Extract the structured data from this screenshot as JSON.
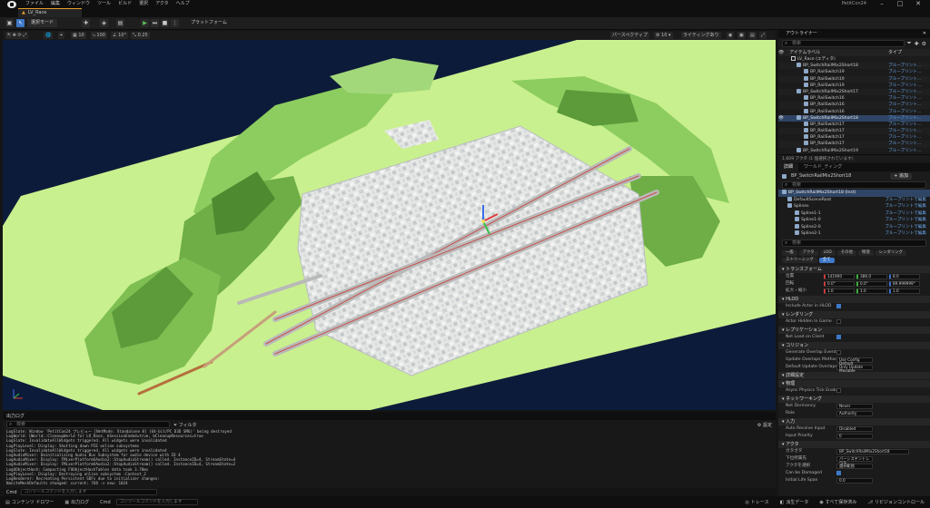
{
  "menu": [
    "ファイル",
    "編集",
    "ウィンドウ",
    "ツール",
    "ビルド",
    "選択",
    "アクタ",
    "ヘルプ"
  ],
  "project_name": "PetitCon24",
  "level_tab": "LV_Race",
  "toolbar": {
    "mode": "選択モード",
    "platform": "プラットフォーム"
  },
  "viewport_toolbar": {
    "grid": "10",
    "rotate": "10°",
    "scale": "0.25",
    "camera_speed": "100",
    "perspective": "パースペクティブ",
    "lit": "ライティングあり"
  },
  "outliner": {
    "title": "アウトライナー",
    "search_placeholder": "検索",
    "col_label": "アイテムラベル",
    "col_type": "タイプ",
    "rows": [
      {
        "name": "LV_Race (エディタ)",
        "type": "",
        "kind": "level",
        "sel": false
      },
      {
        "name": "BP_SwitchRailMix2Short18",
        "type": "ブループリント...",
        "kind": "actor",
        "sel": false
      },
      {
        "name": "BP_RailSwitch19",
        "type": "ブループリント...",
        "kind": "actor",
        "sel": false
      },
      {
        "name": "BP_RailSwitch19",
        "type": "ブループリント...",
        "kind": "actor",
        "sel": false
      },
      {
        "name": "BP_RailSwitch19",
        "type": "ブループリント...",
        "kind": "actor",
        "sel": false
      },
      {
        "name": "BP_SwitchRailMix2Short17",
        "type": "ブループリント...",
        "kind": "actor",
        "sel": false
      },
      {
        "name": "BP_RailSwitch16",
        "type": "ブループリント...",
        "kind": "actor",
        "sel": false
      },
      {
        "name": "BP_RailSwitch16",
        "type": "ブループリント...",
        "kind": "actor",
        "sel": false
      },
      {
        "name": "BP_RailSwitch16",
        "type": "ブループリント...",
        "kind": "actor",
        "sel": false
      },
      {
        "name": "BP_SwitchRailMix2Short18",
        "type": "ブループリント...",
        "kind": "actor",
        "sel": true
      },
      {
        "name": "BP_RailSwitch17",
        "type": "ブループリント...",
        "kind": "actor",
        "sel": false
      },
      {
        "name": "BP_RailSwitch17",
        "type": "ブループリント...",
        "kind": "actor",
        "sel": false
      },
      {
        "name": "BP_RailSwitch17",
        "type": "ブループリント...",
        "kind": "actor",
        "sel": false
      },
      {
        "name": "BP_RailSwitch17",
        "type": "ブループリント...",
        "kind": "actor",
        "sel": false
      },
      {
        "name": "BP_SwitchRailMix2Short19",
        "type": "ブループリント...",
        "kind": "actor",
        "sel": false
      }
    ],
    "footer": "1,609 アクタ (1 個選択されています)"
  },
  "details": {
    "tab_details": "詳細",
    "tab_world": "ワールド_ティング",
    "actor_name": "BP_SwitchRailMix2Short18",
    "add_label": "+ 追加",
    "components": [
      {
        "name": "BP_SwitchRailMix2Short18 (Inst)",
        "link": "",
        "sel": true
      },
      {
        "name": "DefaultSceneRoot",
        "link": "ブループリントで編集",
        "sel": false
      },
      {
        "name": "Splines",
        "link": "ブループリントで編集",
        "sel": false
      },
      {
        "name": "Spline1-1",
        "link": "ブループリントで編集",
        "sel": false
      },
      {
        "name": "Spline1-0",
        "link": "ブループリントで編集",
        "sel": false
      },
      {
        "name": "Spline2-0",
        "link": "ブループリントで編集",
        "sel": false
      },
      {
        "name": "Spline2-1",
        "link": "ブループリントで編集",
        "sel": false
      }
    ],
    "categories": [
      "一般",
      "アクタ",
      "LOD",
      "その他",
      "物理",
      "レンダリング",
      "ストリーミング",
      "全て"
    ],
    "transform_section": "トランスフォーム",
    "transform_rows": [
      {
        "label": "位置",
        "x": "141900",
        "y": "386.0",
        "z": "8.0"
      },
      {
        "label": "回転",
        "x": "0.0°",
        "y": "0.0°",
        "z": "89.999999°"
      },
      {
        "label": "拡大・縮小",
        "x": "1.0",
        "y": "1.0",
        "z": "1.0"
      }
    ],
    "sections": [
      {
        "title": "HLOD",
        "props": [
          {
            "label": "Include Actor in HLOD",
            "kind": "check",
            "value": "on"
          }
        ]
      },
      {
        "title": "レンダリング",
        "props": [
          {
            "label": "Actor Hidden In Game",
            "kind": "check",
            "value": "off"
          }
        ]
      },
      {
        "title": "レプリケーション",
        "props": [
          {
            "label": "Net Load on Client",
            "kind": "check",
            "value": "on"
          }
        ]
      },
      {
        "title": "コリジョン",
        "props": [
          {
            "label": "Generate Overlap Events During...",
            "kind": "check",
            "value": "off"
          },
          {
            "label": "Update Overlaps Method During L...",
            "kind": "select",
            "value": "Use Config Default"
          },
          {
            "label": "Default Update Overlaps Method...",
            "kind": "select",
            "value": "Only Update Movable"
          }
        ]
      },
      {
        "title": "詳細設定",
        "props": []
      },
      {
        "title": "物理",
        "props": [
          {
            "label": "Async Physics Tick Enabled",
            "kind": "check",
            "value": "off"
          }
        ]
      },
      {
        "title": "ネットワーキング",
        "props": [
          {
            "label": "Net Dormancy",
            "kind": "select",
            "value": "Never"
          },
          {
            "label": "Role",
            "kind": "select",
            "value": "Authority"
          }
        ]
      },
      {
        "title": "入力",
        "props": [
          {
            "label": "Auto Receive Input",
            "kind": "select",
            "value": "Disabled"
          },
          {
            "label": "Input Priority",
            "kind": "text",
            "value": "0"
          }
        ]
      },
      {
        "title": "アクタ",
        "props": [
          {
            "label": "ガタガタ",
            "kind": "text",
            "value": "BP_SwitchRailMix2Short18"
          },
          {
            "label": "下位所属先",
            "kind": "text",
            "value": "パーシステントレベル"
          },
          {
            "label": "アクタを選択",
            "kind": "select",
            "value": "選択範囲"
          },
          {
            "label": "Can be Damaged",
            "kind": "check",
            "value": "on"
          },
          {
            "label": "Initial Life Span",
            "kind": "text",
            "value": "0.0"
          }
        ]
      }
    ]
  },
  "output_log": {
    "title": "出力ログ",
    "search_placeholder": "検索",
    "filter_label": "フィルタ",
    "settings_label": "設定",
    "lines": [
      "LogSlate: Window 'PetitCon24 プレビュー [NetMode: Standalone 0] (64-bit/PC D3D SM6)' being destroyed",
      "LogWorld: UWorld::CleanupWorld for LV_Race, bSessionEnded=true, bCleanupResources=true",
      "LogSlate: InvalidateAllWidgets triggered.  All widgets were invalidated",
      "LogPlayLevel: Display: Shutting down PIE online subsystems",
      "LogSlate: InvalidateAllWidgets triggered.  All widgets were invalidated",
      "LogAudioMixer: Deinitializing Audio Bus Subsystem for audio device with ID 4",
      "LogAudioMixer: Display: FMixerPlatformXAudio2::StopAudioStream() called. InstanceID=4, StreamState=4",
      "LogAudioMixer: Display: FMixerPlatformXAudio2::StopAudioStream() called. InstanceID=4, StreamState=2",
      "LogUObjectHash: Compacting FUObjectHashTables data took   3.78ms",
      "LogPlayLevel: Display: Destroying online subsystem :Context_2",
      "LogRenderer: Recreating Persistent SDFs due to initializer changes:",
      "          NaniteMeshDefaults changed: current: 768 -> new: 1024"
    ],
    "cmd_label": "Cmd",
    "cmd_placeholder": "コンソールコマンドを入力します"
  },
  "statusbar": {
    "content_drawer": "コンテンツ ドロワー",
    "output_log": "出力ログ",
    "cmd": "Cmd",
    "cmd_placeholder": "コンソールコマンドを入力します",
    "trace": "トレース",
    "derived_data": "派生データ",
    "save_all": "すべて保存済み",
    "source_control": "リビジョンコントロール"
  },
  "colors": {
    "accent": "#e59e29",
    "selection": "#2f4565",
    "link": "#6aa6e8",
    "terrain": "#c9f08e",
    "mountain": "#7fbf52",
    "sky": "#0d1b3a"
  }
}
